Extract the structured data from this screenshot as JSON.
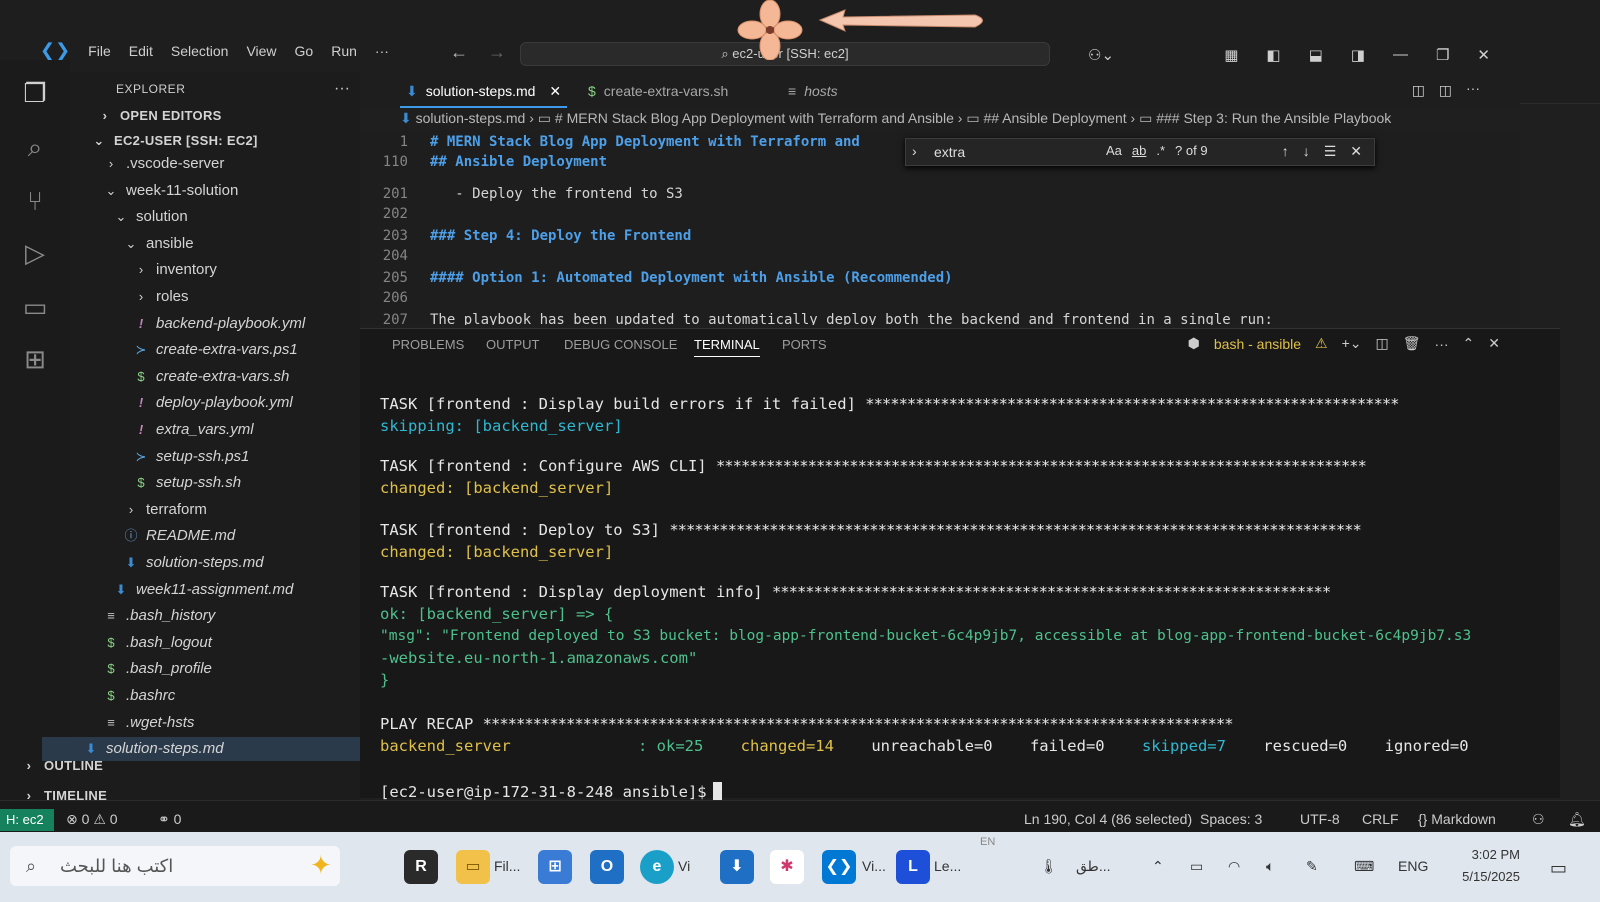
{
  "titlebar": {
    "menu": [
      "File",
      "Edit",
      "Selection",
      "View",
      "Go",
      "Run",
      "···"
    ],
    "command_center": "ec2-user [SSH: ec2]"
  },
  "sidebar": {
    "header": "EXPLORER",
    "open_editors": "OPEN EDITORS",
    "workspace": "EC2-USER [SSH: EC2]",
    "items": [
      {
        "label": ".vscode-server",
        "kind": "folder-collapsed",
        "depth": 1
      },
      {
        "label": "week-11-solution",
        "kind": "folder-open",
        "depth": 1
      },
      {
        "label": "solution",
        "kind": "folder-open",
        "depth": 2
      },
      {
        "label": "ansible",
        "kind": "folder-open",
        "depth": 3
      },
      {
        "label": "inventory",
        "kind": "folder-collapsed",
        "depth": 4
      },
      {
        "label": "roles",
        "kind": "folder-collapsed",
        "depth": 4
      },
      {
        "label": "backend-playbook.yml",
        "kind": "yml",
        "depth": 4
      },
      {
        "label": "create-extra-vars.ps1",
        "kind": "ps1",
        "depth": 4
      },
      {
        "label": "create-extra-vars.sh",
        "kind": "sh",
        "depth": 4
      },
      {
        "label": "deploy-playbook.yml",
        "kind": "yml",
        "depth": 4
      },
      {
        "label": "extra_vars.yml",
        "kind": "yml",
        "depth": 4
      },
      {
        "label": "setup-ssh.ps1",
        "kind": "ps1",
        "depth": 4
      },
      {
        "label": "setup-ssh.sh",
        "kind": "sh",
        "depth": 4
      },
      {
        "label": "terraform",
        "kind": "folder-collapsed",
        "depth": 3
      },
      {
        "label": "README.md",
        "kind": "info",
        "depth": 3
      },
      {
        "label": "solution-steps.md",
        "kind": "md",
        "depth": 3
      },
      {
        "label": "week11-assignment.md",
        "kind": "md",
        "depth": 2
      },
      {
        "label": ".bash_history",
        "kind": "txt",
        "depth": 1
      },
      {
        "label": ".bash_logout",
        "kind": "sh",
        "depth": 1
      },
      {
        "label": ".bash_profile",
        "kind": "sh",
        "depth": 1
      },
      {
        "label": ".bashrc",
        "kind": "sh",
        "depth": 1
      },
      {
        "label": ".wget-hsts",
        "kind": "txt",
        "depth": 1
      },
      {
        "label": "solution-steps.md",
        "kind": "md",
        "depth": 0,
        "selected": true
      }
    ],
    "outline": "OUTLINE",
    "timeline": "TIMELINE"
  },
  "tabs": [
    {
      "label": "solution-steps.md",
      "icon": "markdown-icon",
      "active": true
    },
    {
      "label": "create-extra-vars.sh",
      "icon": "dollar-icon",
      "active": false
    },
    {
      "label": "hosts",
      "icon": "lines-icon",
      "active": false
    }
  ],
  "breadcrumb": [
    "solution-steps.md",
    "# MERN Stack Blog App Deployment with Terraform and Ansible",
    "## Ansible Deployment",
    "### Step 3: Run the Ansible Playbook"
  ],
  "editor": {
    "lines": [
      {
        "num": "1",
        "text": "# MERN Stack Blog App Deployment with Terraform and",
        "style": "heading"
      },
      {
        "num": "110",
        "text": "## Ansible Deployment",
        "style": "heading"
      },
      {
        "num": "201",
        "text": "   - Deploy the frontend to S3",
        "style": "text"
      },
      {
        "num": "202",
        "text": "",
        "style": "text"
      },
      {
        "num": "203",
        "text": "### Step 4: Deploy the Frontend",
        "style": "heading"
      },
      {
        "num": "204",
        "text": "",
        "style": "text"
      },
      {
        "num": "205",
        "text": "#### Option 1: Automated Deployment with Ansible (Recommended)",
        "style": "heading"
      },
      {
        "num": "206",
        "text": "",
        "style": "text"
      },
      {
        "num": "207",
        "text": "The playbook has been updated to automatically deploy both the backend and frontend in a single run:",
        "style": "text"
      }
    ]
  },
  "find": {
    "query": "extra",
    "case_label": "Aa",
    "word_label": "ab",
    "regex_label": ".*",
    "result": "? of 9"
  },
  "panel": {
    "tabs": [
      "PROBLEMS",
      "OUTPUT",
      "DEBUG CONSOLE",
      "TERMINAL",
      "PORTS"
    ],
    "active_tab": "TERMINAL",
    "terminal_name": "bash - ansible"
  },
  "terminal": {
    "task1": "TASK [frontend : Display build errors if it failed]",
    "task1_result_label": "skipping:",
    "task1_result_host": "[backend_server]",
    "task2": "TASK [frontend : Configure AWS CLI]",
    "task2_result": "changed: [backend_server]",
    "task3": "TASK [frontend : Deploy to S3]",
    "task3_result": "changed: [backend_server]",
    "task4": "TASK [frontend : Display deployment info]",
    "task4_ok": "ok: [backend_server] => {",
    "task4_msg_1": "    \"msg\": \"Frontend deployed to S3 bucket: blog-app-frontend-bucket-6c4p9jb7, accessible at blog-app-frontend-bucket-6c4p9jb7.s3",
    "task4_msg_2": "-website.eu-north-1.amazonaws.com\"",
    "task4_close": "}",
    "recap": "PLAY RECAP",
    "recap_host": "backend_server",
    "recap_ok": ": ok=25",
    "recap_changed": "changed=14",
    "recap_unreachable": "unreachable=0",
    "recap_failed": "failed=0",
    "recap_skipped": "skipped=7",
    "recap_rescued": "rescued=0",
    "recap_ignored": "ignored=0",
    "prompt": "[ec2-user@ip-172-31-8-248 ansible]$"
  },
  "statusbar": {
    "remote": "H: ec2",
    "errors": "0",
    "warnings": "0",
    "ports": "0",
    "position": "Ln 190, Col 4 (86 selected)",
    "spaces": "Spaces: 3",
    "encoding": "UTF-8",
    "eol": "CRLF",
    "language": "Markdown"
  },
  "taskbar": {
    "search_placeholder": "اكتب هنا للبحث",
    "explorer_label": "Fil...",
    "edge_label": "Vi",
    "vscode_label": "Vi...",
    "le_label": "Le...",
    "weather": "طق...",
    "lang": "ENG",
    "time": "3:02 PM",
    "date": "5/15/2025",
    "en_badge": "EN"
  },
  "colors": {
    "accent": "#3c9ae8",
    "terminal_cyan": "#2fb8d1",
    "terminal_yellow": "#dfc04a",
    "terminal_green": "#4ec08c",
    "remote_bg": "#16825d"
  }
}
